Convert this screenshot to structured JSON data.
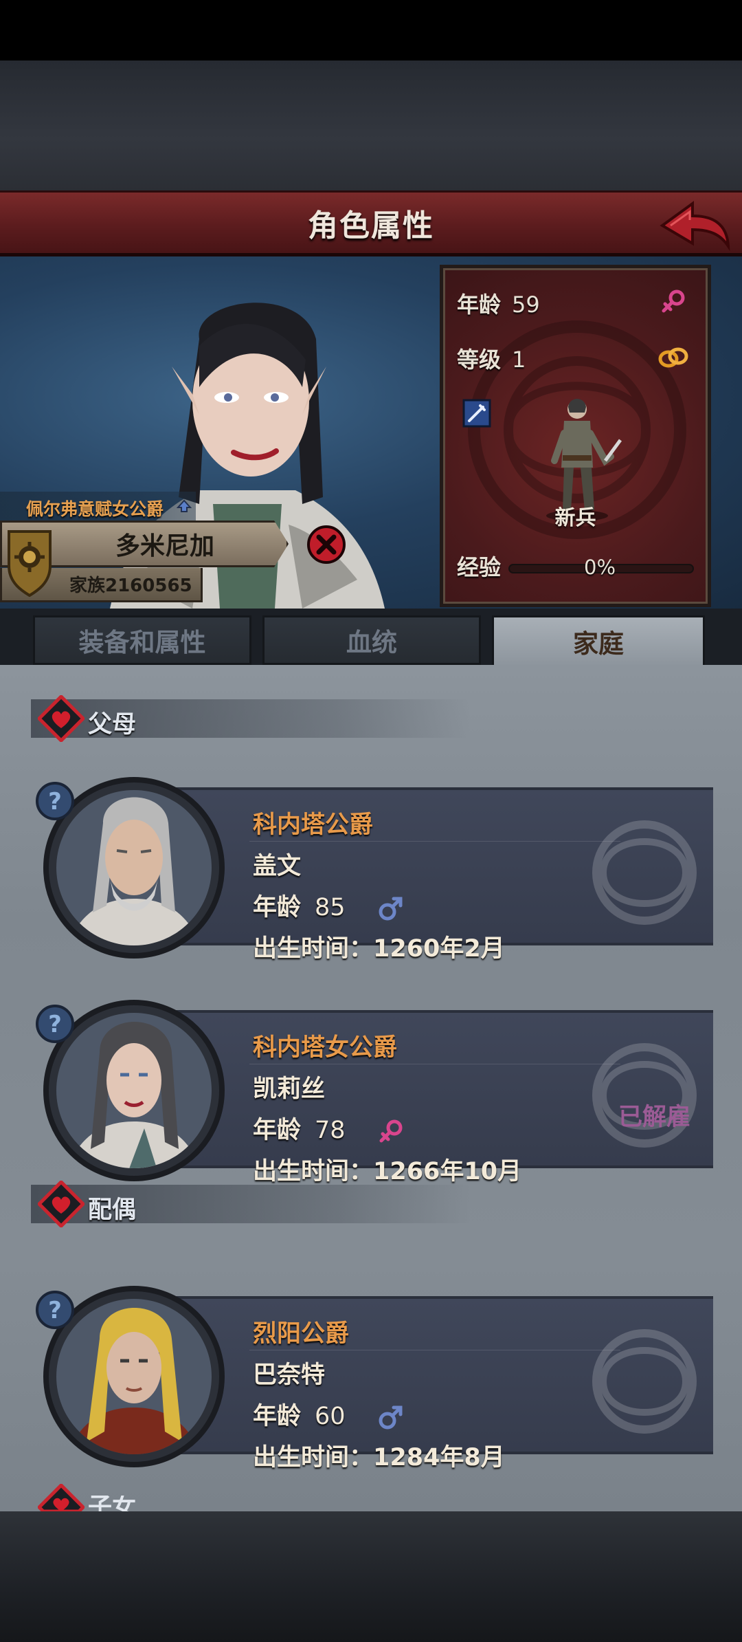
{
  "header": {
    "title": "角色属性"
  },
  "character": {
    "title": "佩尔弗意赋女公爵",
    "name": "多米尼加",
    "family": "家族2160565",
    "stats": {
      "age_label": "年龄",
      "age": "59",
      "level_label": "等级",
      "level": "1",
      "class": "新兵",
      "exp_label": "经验",
      "exp": "0%",
      "exp_fraction": 0.0
    }
  },
  "tabs": [
    {
      "label": "装备和属性",
      "active": false
    },
    {
      "label": "血统",
      "active": false
    },
    {
      "label": "家庭",
      "active": true
    }
  ],
  "sections": {
    "parents": "父母",
    "spouse": "配偶",
    "children_partial": "子女"
  },
  "members": [
    {
      "rank": "科内塔公爵",
      "name": "盖文",
      "age_label": "年龄",
      "age": "85",
      "gender": "male",
      "birth": "出生时间：1260年2月",
      "status": ""
    },
    {
      "rank": "科内塔女公爵",
      "name": "凯莉丝",
      "age_label": "年龄",
      "age": "78",
      "gender": "female",
      "birth": "出生时间：1266年10月",
      "status": "已解雇"
    },
    {
      "rank": "烈阳公爵",
      "name": "巴奈特",
      "age_label": "年龄",
      "age": "60",
      "gender": "male",
      "birth": "出生时间：1284年8月",
      "status": ""
    }
  ],
  "colors": {
    "title_bar": "#5c1c1e",
    "rank_text": "#e89a4a",
    "male": "#6d86c8",
    "female": "#d9458d",
    "dismissed": "#9b5b95"
  },
  "icons": [
    "back-arrow-icon",
    "female-icon",
    "male-icon",
    "ring-icon",
    "sword-skill-icon",
    "close-icon",
    "heart-icon",
    "help-icon",
    "family-shield-icon"
  ]
}
